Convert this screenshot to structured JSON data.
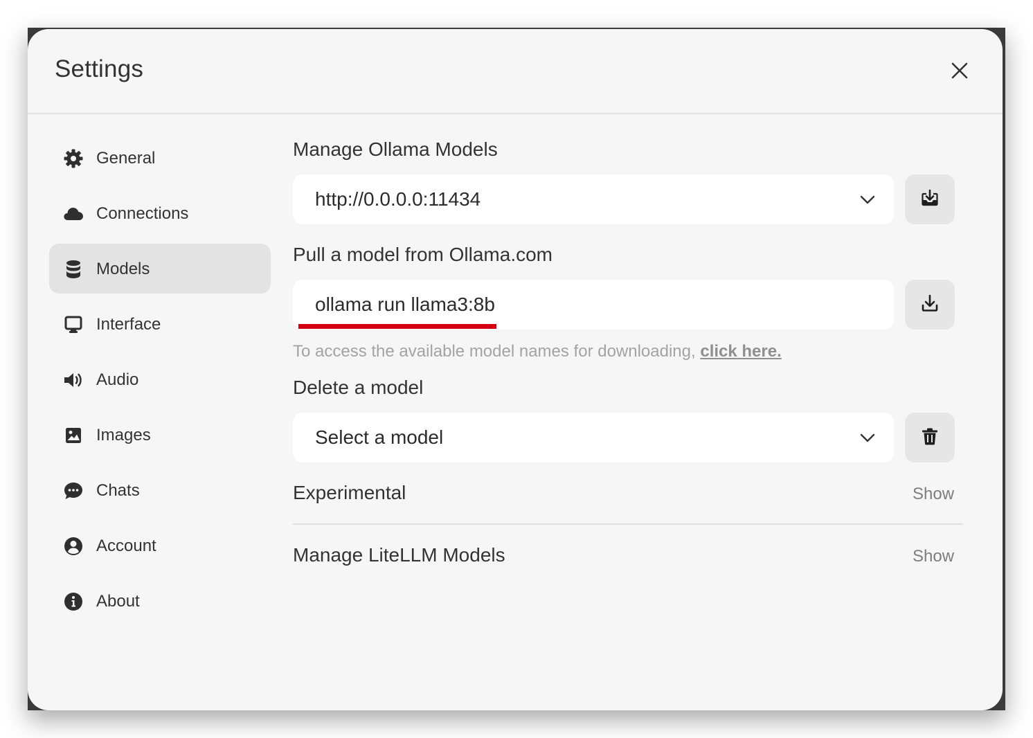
{
  "modal": {
    "title": "Settings",
    "close_icon": "close-icon"
  },
  "sidebar": {
    "items": [
      {
        "label": "General",
        "icon": "gear-icon",
        "active": false
      },
      {
        "label": "Connections",
        "icon": "cloud-icon",
        "active": false
      },
      {
        "label": "Models",
        "icon": "database-icon",
        "active": true
      },
      {
        "label": "Interface",
        "icon": "monitor-icon",
        "active": false
      },
      {
        "label": "Audio",
        "icon": "speaker-icon",
        "active": false
      },
      {
        "label": "Images",
        "icon": "image-icon",
        "active": false
      },
      {
        "label": "Chats",
        "icon": "chat-bubble-icon",
        "active": false
      },
      {
        "label": "Account",
        "icon": "user-circle-icon",
        "active": false
      },
      {
        "label": "About",
        "icon": "info-icon",
        "active": false
      }
    ]
  },
  "main": {
    "manage_ollama": {
      "label": "Manage Ollama Models",
      "selected_url": "http://0.0.0.0:11434",
      "button_icon": "download-tray-icon"
    },
    "pull_model": {
      "label": "Pull a model from Ollama.com",
      "input_value": "ollama run llama3:8b",
      "button_icon": "download-icon",
      "hint_text": "To access the available model names for downloading,",
      "hint_link": "click here."
    },
    "delete_model": {
      "label": "Delete a model",
      "placeholder": "Select a model",
      "button_icon": "trash-icon"
    },
    "experimental": {
      "label": "Experimental",
      "toggle": "Show"
    },
    "litellm": {
      "label": "Manage LiteLLM Models",
      "toggle": "Show"
    }
  },
  "colors": {
    "modal_bg": "#f6f6f6",
    "active_item_bg": "#e3e3e3",
    "annotation_underline": "#d40012",
    "muted_text": "#a3a3a3"
  }
}
